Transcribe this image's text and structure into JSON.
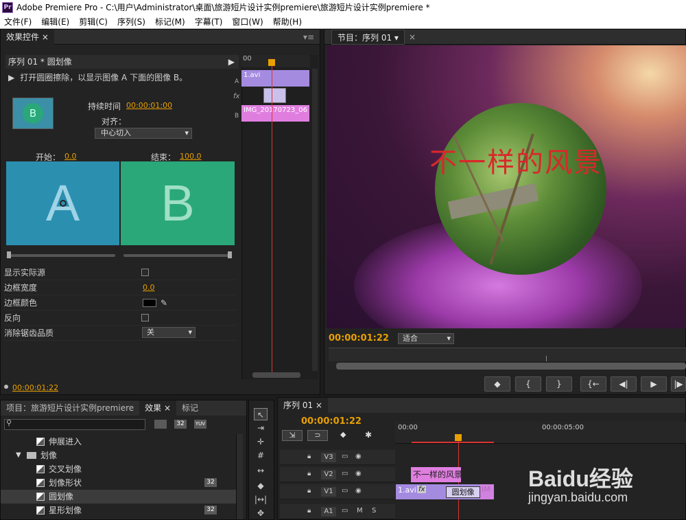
{
  "window": {
    "title": "Adobe Premiere Pro - C:\\用户\\Administrator\\桌面\\旅游短片设计实例premiere\\旅游短片设计实例premiere *"
  },
  "menu": [
    "文件(F)",
    "编辑(E)",
    "剪辑(C)",
    "序列(S)",
    "标记(M)",
    "字幕(T)",
    "窗口(W)",
    "帮助(H)"
  ],
  "effect_controls": {
    "tab": "效果控件",
    "clip_path": "序列 01 * 圆划像",
    "description": "打开圆圈擦除，以显示图像 A 下面的图像 B。",
    "duration_label": "持续时间",
    "duration_value": "00:00:01:00",
    "align_label": "对齐：",
    "align_value": "中心切入",
    "start_label": "开始：",
    "start_value": "0.0",
    "end_label": "结束：",
    "end_value": "100.0",
    "preview_a": "A",
    "preview_b": "B",
    "thumb_letter": "B",
    "show_actual_sources": "显示实际源",
    "border_width_label": "边框宽度",
    "border_width_value": "0.0",
    "border_color_label": "边框颜色",
    "reverse_label": "反向",
    "antialias_label": "消除锯齿品质",
    "antialias_value": "关",
    "timecode": "00:00:01:22",
    "mini_ruler": "00",
    "mini_clip_a": "1.avi",
    "mini_clip_b": "IMG_20170723_06",
    "track_a": "A",
    "track_b": "B"
  },
  "program_monitor": {
    "tab": "节目：序列 01",
    "overlay_text": "不一样的风景",
    "timecode": "00:00:01:22",
    "fit": "适合",
    "buttons": [
      "◆",
      "{",
      "}",
      "{←",
      "◀|",
      "▶",
      "|▶"
    ]
  },
  "project_panel": {
    "tabs": [
      "项目：旅游短片设计实例premiere",
      "效果",
      "标记"
    ],
    "search_placeholder": "",
    "items": [
      {
        "label": "伸展进入",
        "type": "effect",
        "badge": ""
      },
      {
        "label": "划像",
        "type": "folder",
        "badge": ""
      },
      {
        "label": "交叉划像",
        "type": "effect",
        "badge": ""
      },
      {
        "label": "划像形状",
        "type": "effect",
        "badge": "32"
      },
      {
        "label": "圆划像",
        "type": "effect",
        "badge": "",
        "selected": true
      },
      {
        "label": "星形划像",
        "type": "effect",
        "badge": "32"
      }
    ]
  },
  "timeline": {
    "tab": "序列 01",
    "timecode": "00:00:01:22",
    "ruler": [
      "00:00",
      "00:00:05:00"
    ],
    "tracks": [
      "V3",
      "V2",
      "V1",
      "A1"
    ],
    "clip_title": "不一样的风景",
    "clip_v1": "1.avi",
    "clip_v1_fx": "fx",
    "transition": "圆划像",
    "clip_v1b": "IM"
  },
  "watermark": {
    "brand": "Baidu经验",
    "url": "jingyan.baidu.com"
  },
  "colors": {
    "accent": "#e8a000",
    "clip_purple": "#a48be0",
    "clip_pink": "#e07ee0",
    "preview_a": "#2b8fb0",
    "preview_b": "#2aa87a",
    "playhead": "#d33"
  }
}
